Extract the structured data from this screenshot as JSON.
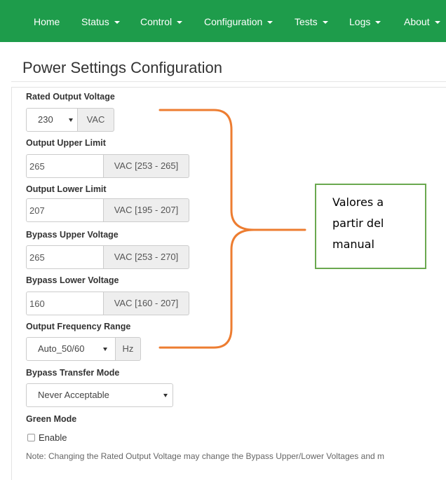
{
  "navbar": {
    "items": [
      {
        "label": "Home",
        "dropdown": false
      },
      {
        "label": "Status",
        "dropdown": true
      },
      {
        "label": "Control",
        "dropdown": true
      },
      {
        "label": "Configuration",
        "dropdown": true
      },
      {
        "label": "Tests",
        "dropdown": true
      },
      {
        "label": "Logs",
        "dropdown": true
      },
      {
        "label": "About",
        "dropdown": true
      }
    ],
    "background": "#1e9c4b"
  },
  "page": {
    "title": "Power Settings Configuration"
  },
  "form": {
    "rated_output_voltage": {
      "label": "Rated Output Voltage",
      "value": "230",
      "unit": "VAC"
    },
    "output_upper_limit": {
      "label": "Output Upper Limit",
      "value": "265",
      "range": "VAC [253 - 265]"
    },
    "output_lower_limit": {
      "label": "Output Lower Limit",
      "value": "207",
      "range": "VAC [195 - 207]"
    },
    "bypass_upper_voltage": {
      "label": "Bypass Upper Voltage",
      "value": "265",
      "range": "VAC [253 - 270]"
    },
    "bypass_lower_voltage": {
      "label": "Bypass Lower Voltage",
      "value": "160",
      "range": "VAC [160 - 207]"
    },
    "output_frequency_range": {
      "label": "Output Frequency Range",
      "value": "Auto_50/60",
      "unit": "Hz"
    },
    "bypass_transfer_mode": {
      "label": "Bypass Transfer Mode",
      "value": "Never Acceptable"
    },
    "green_mode": {
      "label": "Green Mode",
      "checkbox_label": "Enable",
      "checked": false
    },
    "note": "Note: Changing the Rated Output Voltage may change the Bypass Upper/Lower Voltages and m"
  },
  "annotation": {
    "lines": [
      "Valores a",
      "partir del",
      "manual"
    ],
    "brace_color": "#ed7d31",
    "border_color": "#6aa84f"
  }
}
